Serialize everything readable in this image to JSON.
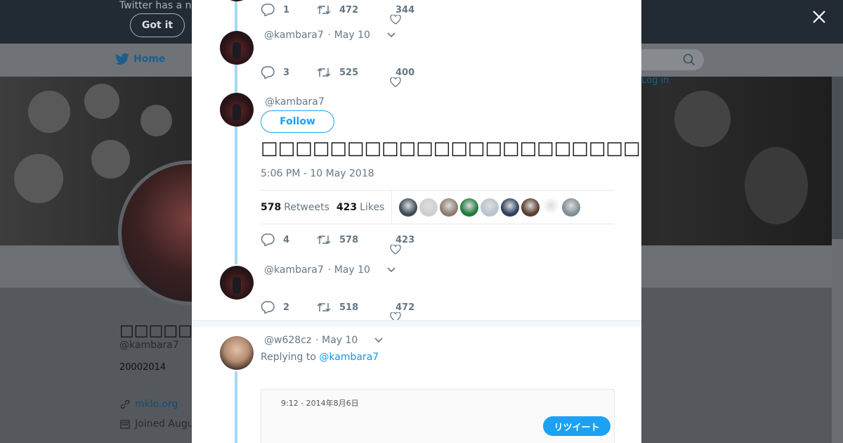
{
  "background": {
    "notice_text": "Twitter has a n",
    "got_it_label": "Got it",
    "nav_home_label": "Home",
    "login_partial": "Log in",
    "profile_name": "□□□□□□□",
    "profile_handle": "@kambara7",
    "profile_bio": "20002014",
    "profile_link": "mklo.org",
    "profile_joined": "Joined Augu"
  },
  "tweets": [
    {
      "reply_count": "1",
      "retweet_count": "472",
      "like_count": "344"
    },
    {
      "handle": "@kambara7",
      "date": "· May 10",
      "reply_count": "3",
      "retweet_count": "525",
      "like_count": "400"
    }
  ],
  "focused_tweet": {
    "handle": "@kambara7",
    "follow_label": "Follow",
    "text": "□□□□□□□□□□□□□□□□□□□□□□□□□□□□□□□□□□□□□□□□□□□□□□□□□□□□□□□□□□□□□□□□□□□□□□□□",
    "timestamp": "5:06 PM - 10 May 2018",
    "retweets_value": "578",
    "retweets_label": "Retweets",
    "likes_value": "423",
    "likes_label": "Likes",
    "reply_count": "4",
    "retweet_count": "578",
    "like_count": "423"
  },
  "tweet_after": {
    "handle": "@kambara7",
    "date": "· May 10",
    "reply_count": "2",
    "retweet_count": "518",
    "like_count": "472"
  },
  "reply_tweet": {
    "handle": "@w628cz",
    "date": "· May 10",
    "replying_prefix": "Replying to",
    "replying_to": "@kambara7",
    "quote_text": "· · · · · · · · · · · ·",
    "quote_time": "9:12 - 2014年8月6日",
    "quote_button": "リツイート"
  },
  "colors": {
    "accent": "#1da1f2",
    "thread_line": "#a4d9f4",
    "muted_text": "#657786"
  },
  "liker_colors": [
    "#3e4a57",
    "#cfcfcf",
    "#8b7d6e",
    "#1f7a3a",
    "#b8c4cf",
    "#2c3f5c",
    "#5a3b2d",
    "#ffffff",
    "#7e8d95"
  ]
}
